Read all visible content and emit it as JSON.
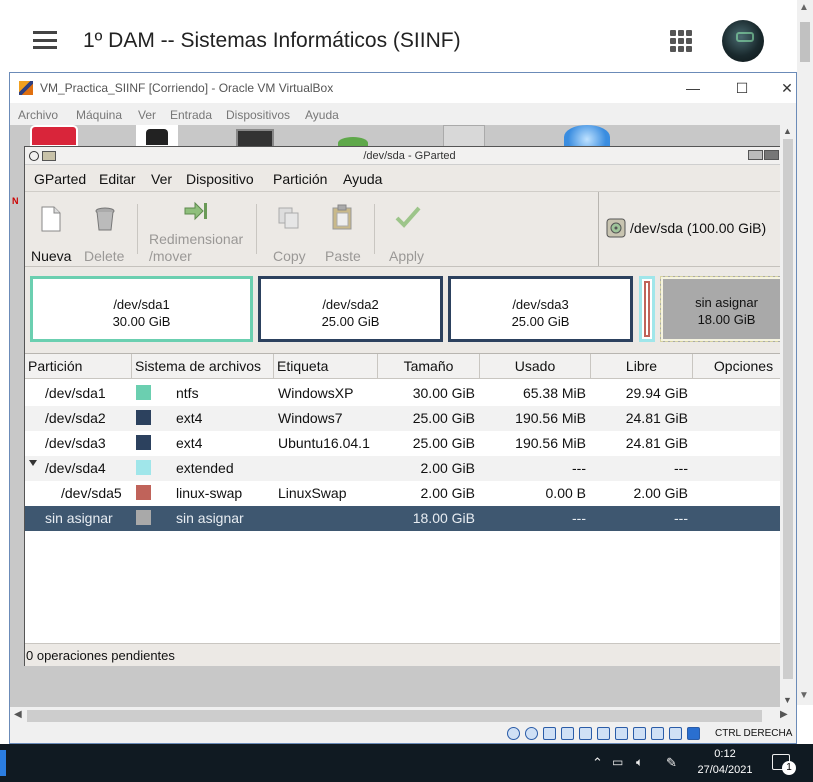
{
  "classroom": {
    "title": "1º DAM -- Sistemas Informáticos (SIINF)"
  },
  "vbox": {
    "window_title": "VM_Practica_SIINF [Corriendo] - Oracle VM VirtualBox",
    "controls": {
      "minimize": "—",
      "maximize": "☐",
      "close": "✕"
    },
    "menu": [
      "Archivo",
      "Máquina",
      "Ver",
      "Entrada",
      "Dispositivos",
      "Ayuda"
    ],
    "host_key": "CTRL DERECHA"
  },
  "gparted": {
    "window_title": "/dev/sda - GParted",
    "menu": {
      "gparted": "GParted",
      "editar": "Editar",
      "ver": "Ver",
      "dispositivo": "Dispositivo",
      "particion": "Partición",
      "ayuda": "Ayuda"
    },
    "toolbar": {
      "nueva": "Nueva",
      "delete": "Delete",
      "resize_line1": "Redimensionar",
      "resize_line2": "/mover",
      "copy": "Copy",
      "paste": "Paste",
      "apply": "Apply"
    },
    "device_selector": "/dev/sda  (100.00 GiB)",
    "diskmap": [
      {
        "name": "/dev/sda1",
        "size": "30.00 GiB",
        "color": "#6bcfb0"
      },
      {
        "name": "/dev/sda2",
        "size": "25.00 GiB",
        "color": "#2c415e"
      },
      {
        "name": "/dev/sda3",
        "size": "25.00 GiB",
        "color": "#2c415e"
      },
      {
        "name": "sin asignar",
        "size": "18.00 GiB",
        "color": "#a9a9a9"
      }
    ],
    "columns": [
      "Partición",
      "Sistema de archivos",
      "Etiqueta",
      "Tamaño",
      "Usado",
      "Libre",
      "Opciones"
    ],
    "rows": [
      {
        "partition": "/dev/sda1",
        "fs": "ntfs",
        "fs_color": "#6bcfb0",
        "label": "WindowsXP",
        "size": "30.00 GiB",
        "used": "65.38 MiB",
        "free": "29.94 GiB"
      },
      {
        "partition": "/dev/sda2",
        "fs": "ext4",
        "fs_color": "#2c415e",
        "label": "Windows7",
        "size": "25.00 GiB",
        "used": "190.56 MiB",
        "free": "24.81 GiB"
      },
      {
        "partition": "/dev/sda3",
        "fs": "ext4",
        "fs_color": "#2c415e",
        "label": "Ubuntu16.04.1",
        "size": "25.00 GiB",
        "used": "190.56 MiB",
        "free": "24.81 GiB"
      },
      {
        "partition": "/dev/sda4",
        "fs": "extended",
        "fs_color": "#a0e6ea",
        "label": "",
        "size": "2.00 GiB",
        "used": "---",
        "free": "---"
      },
      {
        "partition": "/dev/sda5",
        "fs": "linux-swap",
        "fs_color": "#c0635a",
        "label": "LinuxSwap",
        "size": "2.00 GiB",
        "used": "0.00 B",
        "free": "2.00 GiB"
      },
      {
        "partition": "sin asignar",
        "fs": "sin asignar",
        "fs_color": "#a9a9a9",
        "label": "",
        "size": "18.00 GiB",
        "used": "---",
        "free": "---"
      }
    ],
    "status": "0 operaciones pendientes"
  },
  "taskbar": {
    "time": "0:12",
    "date": "27/04/2021",
    "notifications": "1"
  }
}
